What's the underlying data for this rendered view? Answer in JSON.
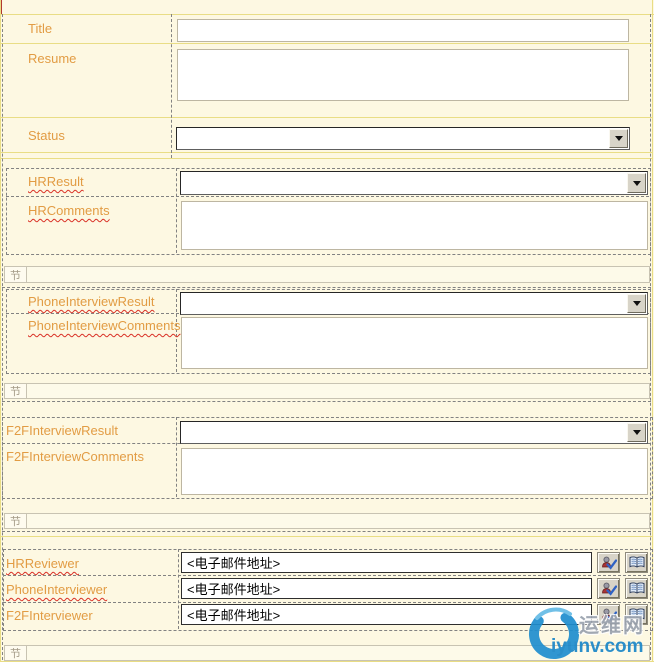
{
  "colors": {
    "background": "#fdf8e2",
    "grid_yellow": "#e9dd85",
    "label_orange": "#e29c44",
    "misspell_red": "#d93025",
    "dashed_gray": "#828282",
    "button_face": "#d8d4c8",
    "watermark_blue": "#1a86c8"
  },
  "top_table": {
    "rows": [
      {
        "label": "Title",
        "control": "textbox"
      },
      {
        "label": "Resume",
        "control": "textarea"
      },
      {
        "label": "Status",
        "control": "dropdown"
      }
    ]
  },
  "sections": [
    {
      "tab": "节",
      "rows": [
        {
          "label": "HRResult",
          "control": "dropdown",
          "spellcheck_flagged": true
        },
        {
          "label": "HRComments",
          "control": "textarea",
          "spellcheck_flagged": true
        }
      ]
    },
    {
      "tab": "节",
      "rows": [
        {
          "label": "PhoneInterviewResult",
          "control": "dropdown",
          "spellcheck_flagged": true
        },
        {
          "label": "PhoneInterviewComments",
          "control": "textarea",
          "spellcheck_flagged": true
        }
      ]
    },
    {
      "tab": "节",
      "rows": [
        {
          "label": "F2FInterviewResult",
          "control": "dropdown",
          "spellcheck_flagged": false
        },
        {
          "label": "F2FInterviewComments",
          "control": "textarea",
          "spellcheck_flagged": false
        }
      ]
    },
    {
      "tab": "节",
      "rows": [
        {
          "label": "HRReviewer",
          "control": "people-picker",
          "value": "<电子邮件地址>",
          "spellcheck_flagged": true
        },
        {
          "label": "PhoneInterviewer",
          "control": "people-picker",
          "value": "<电子邮件地址>",
          "spellcheck_flagged": true
        },
        {
          "label": "F2FInterviewer",
          "control": "people-picker",
          "value": "<电子邮件地址>",
          "spellcheck_flagged": false
        }
      ]
    }
  ],
  "watermark": {
    "site_name": "运维网",
    "site_domain": "iyunv.com"
  }
}
